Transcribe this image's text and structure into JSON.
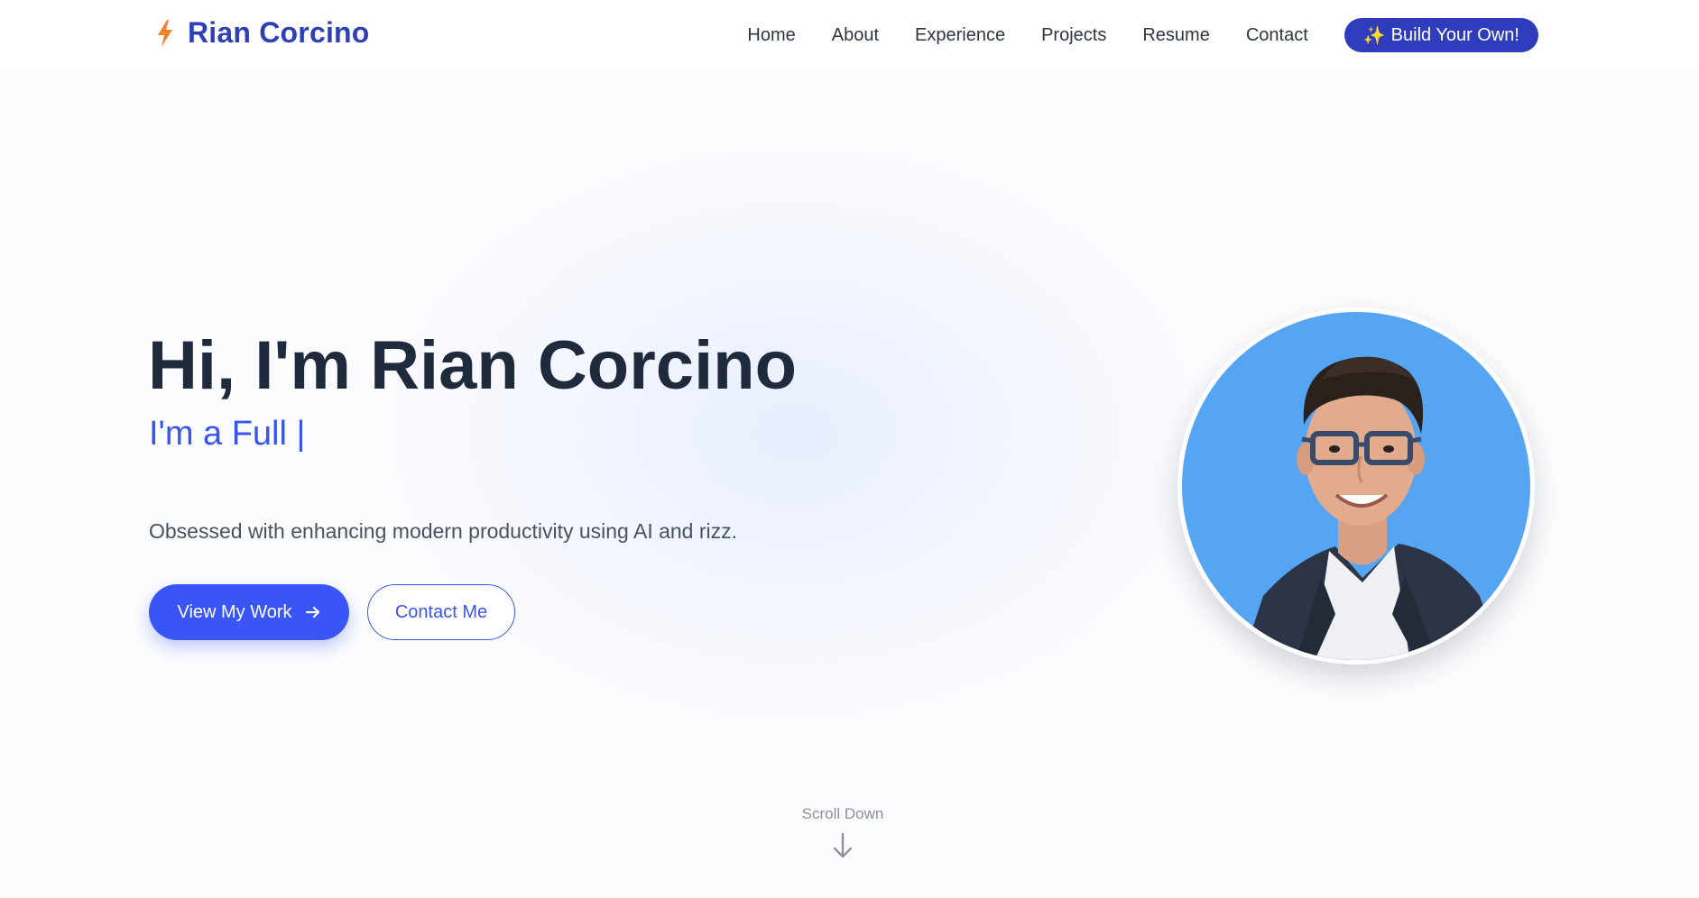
{
  "nav": {
    "brand": "Rian Corcino",
    "links": [
      "Home",
      "About",
      "Experience",
      "Projects",
      "Resume",
      "Contact"
    ],
    "cta": {
      "icon": "sparkles-icon",
      "label": "Build Your Own!"
    }
  },
  "hero": {
    "title": "Hi, I'm Rian Corcino",
    "subtitle": "I'm a Full |",
    "description": "Obsessed with enhancing modern productivity using AI and rizz.",
    "primary_button": "View My Work",
    "secondary_button": "Contact Me"
  },
  "scroll": {
    "label": "Scroll Down"
  },
  "colors": {
    "brand": "#2e3fb8",
    "accent": "#3a55f5",
    "cta_bg": "#2f3dbd",
    "title": "#1f2a3c",
    "bolt": "#f2812e",
    "avatar_bg": "#55a5f2"
  }
}
